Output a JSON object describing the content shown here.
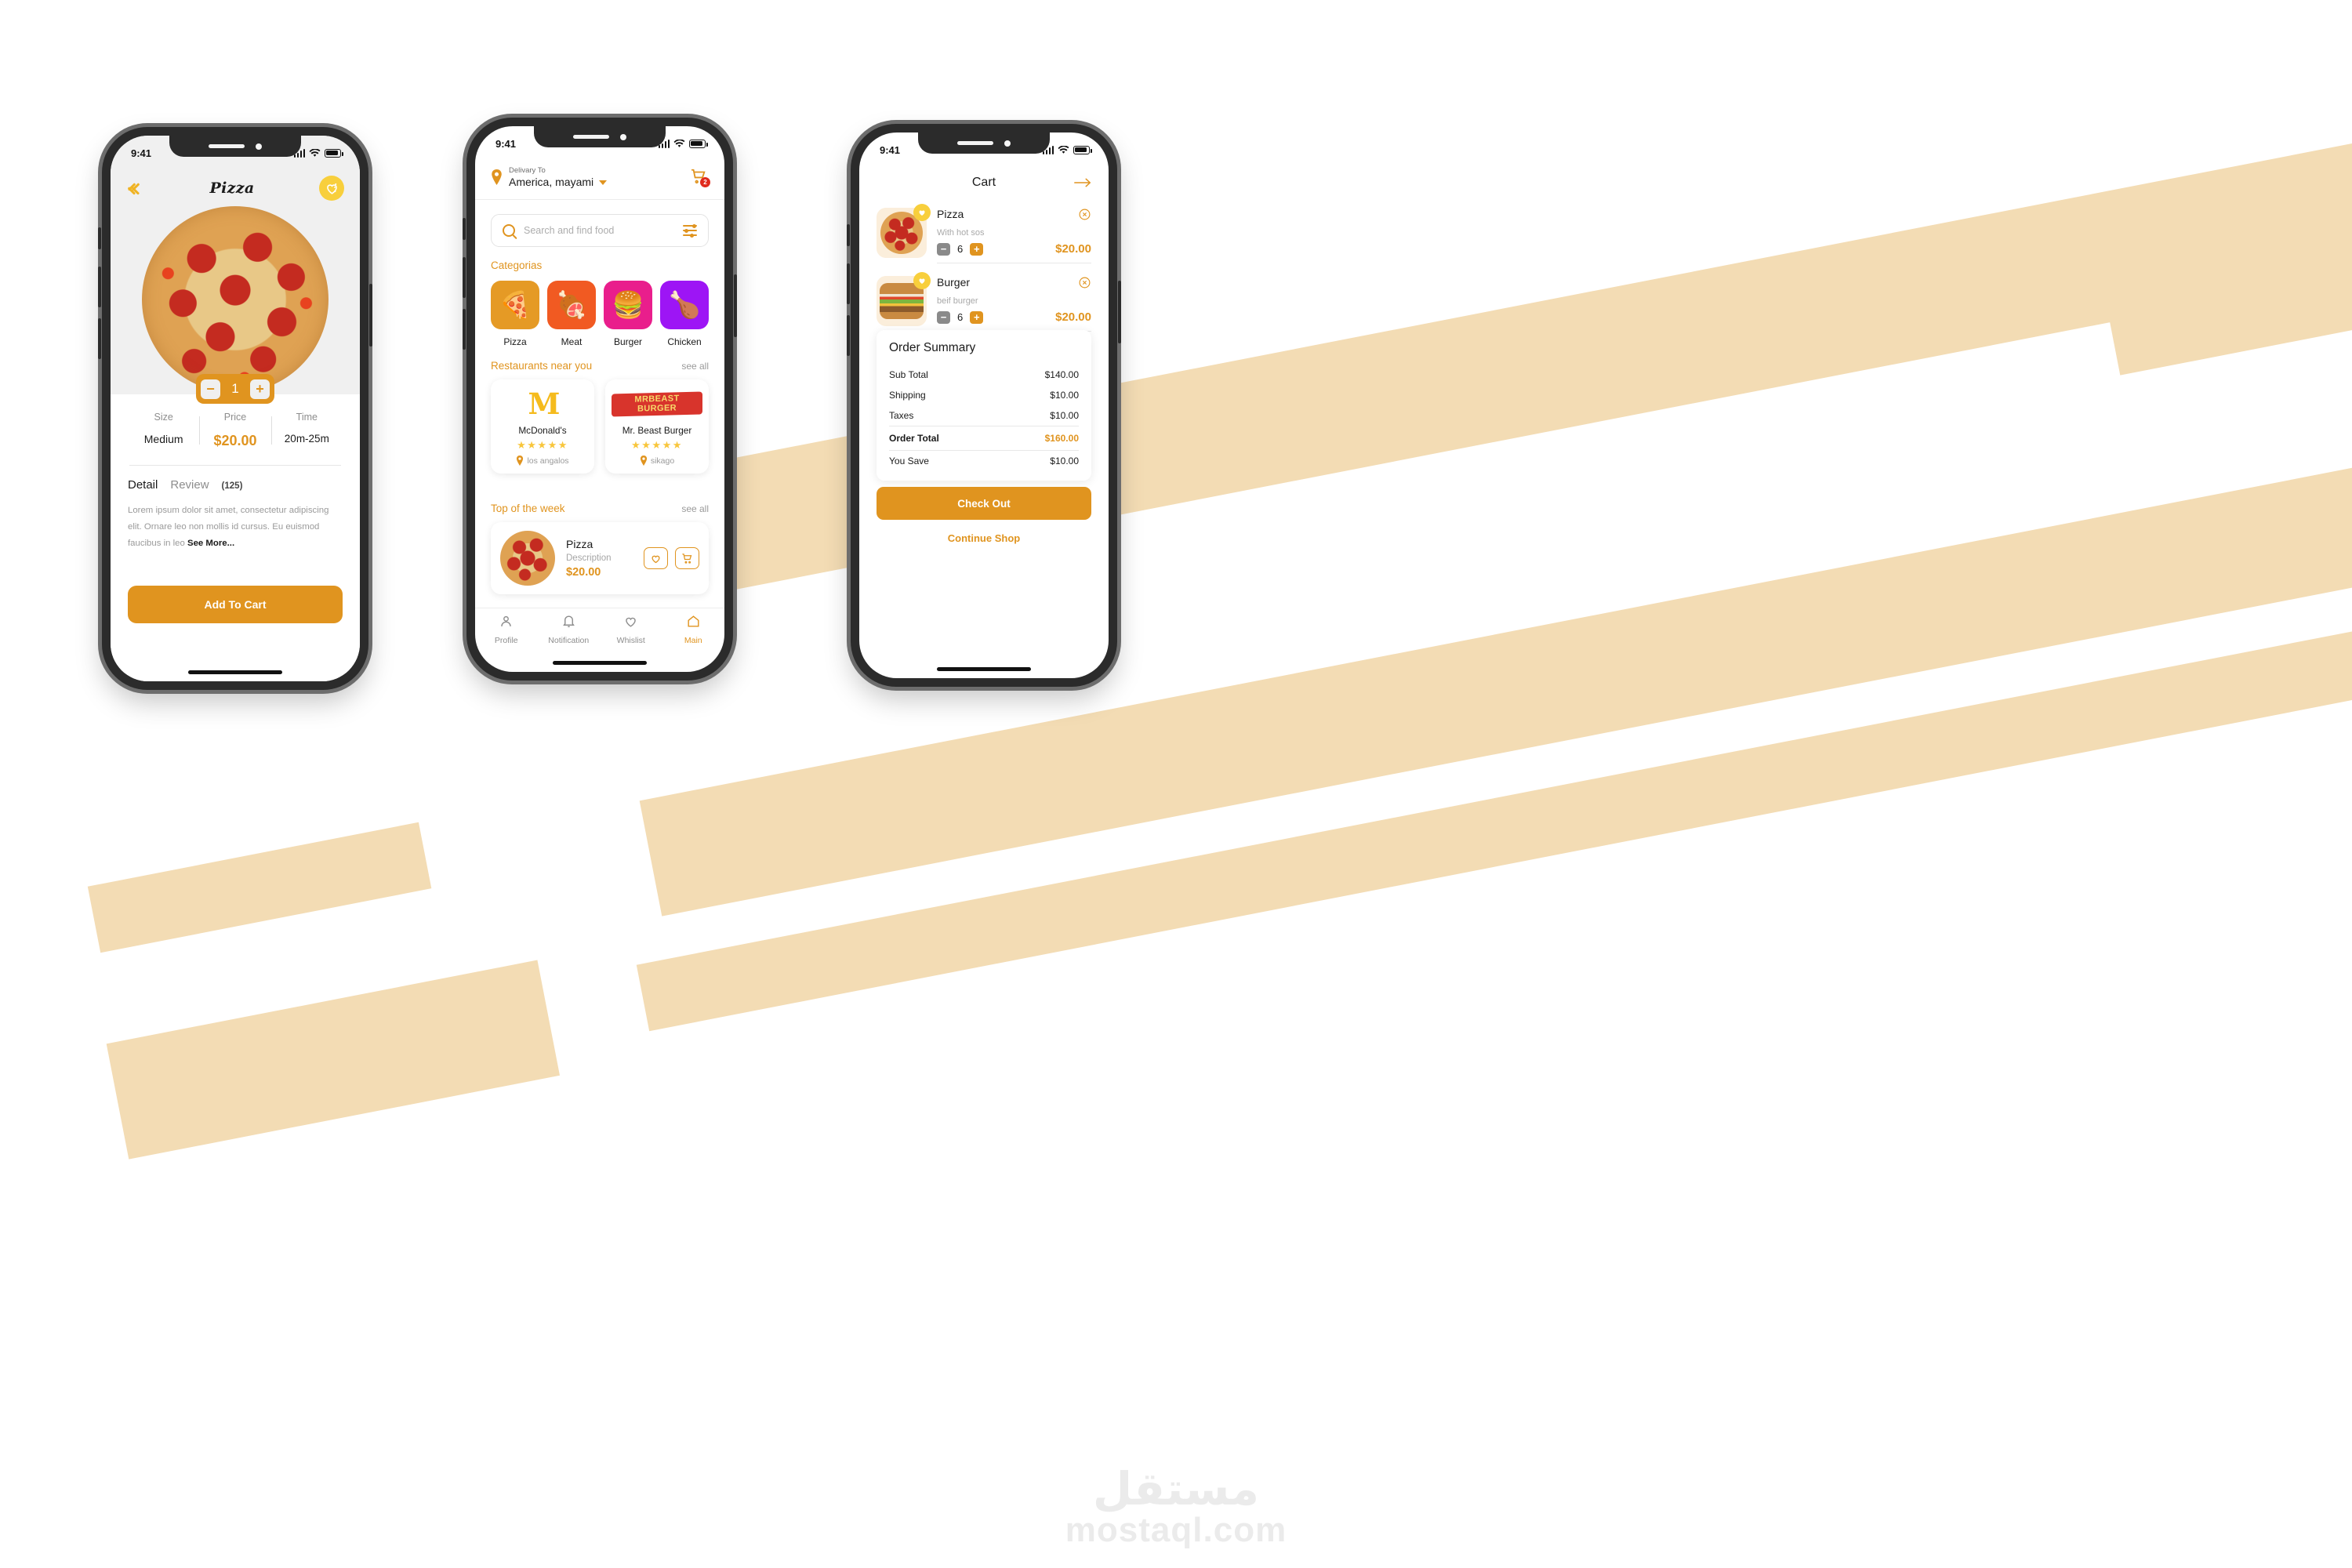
{
  "watermark": {
    "arabic": "مستقل",
    "latin": "mostaql.com"
  },
  "colors": {
    "primary_orange": "#e0941f",
    "accent_yellow": "#f8cf3c",
    "badge_red": "#e02b1d",
    "muted_gray": "#9a9a9a",
    "band_beige": "#f3dcb4"
  },
  "status_bar": {
    "time": "9:41",
    "signal_icon": "signal-bars-icon",
    "wifi_icon": "wifi-icon",
    "battery_icon": "battery-icon"
  },
  "phone1": {
    "nav": {
      "back_icon": "back-arrow-icon",
      "title": "Pizza",
      "favorite_icon": "heart-favorite-icon"
    },
    "hero": {
      "image_alt": "pepperoni-pizza"
    },
    "quantity": {
      "minus": "−",
      "value": "1",
      "plus": "+"
    },
    "specs": [
      {
        "label": "Size",
        "value": "Medium"
      },
      {
        "label": "Price",
        "value": "$20.00"
      },
      {
        "label": "Time",
        "value": "20m-25m"
      }
    ],
    "tabs": {
      "detail": "Detail",
      "review": "Review",
      "review_count": "(125)"
    },
    "description": "Lorem ipsum dolor sit amet, consectetur adipiscing elit. Ornare leo non mollis id cursus. Eu euismod faucibus in leo",
    "see_more": "See More...",
    "cta": "Add To Cart"
  },
  "phone2": {
    "header": {
      "pin_icon": "location-pin-icon",
      "delivery_label": "Delivary To",
      "city": "America, mayami",
      "chevron_icon": "chevron-down-icon",
      "cart_icon": "shopping-cart-icon",
      "cart_badge": "2"
    },
    "search": {
      "icon": "search-icon",
      "placeholder": "Search and find food",
      "filter_icon": "filter-sliders-icon"
    },
    "categories_title": "Categorias",
    "categories": [
      {
        "name": "Pizza",
        "emoji": "🍕",
        "bg": "#e59a25"
      },
      {
        "name": "Meat",
        "emoji": "🍖",
        "bg": "#f15a22"
      },
      {
        "name": "Burger",
        "emoji": "🍔",
        "bg": "#e91e8c"
      },
      {
        "name": "Chicken",
        "emoji": "🍗",
        "bg": "#9d15f5"
      }
    ],
    "restaurants_title": "Restaurants near you",
    "restaurants_see_all": "see all",
    "restaurants": [
      {
        "logo_text": "M",
        "logo_type": "mcdonalds-logo",
        "name": "McDonald's",
        "stars": "★★★★★",
        "location": "los angalos"
      },
      {
        "logo_text": "MRBEAST BURGER",
        "logo_type": "mrbeast-burger-logo",
        "name": "Mr. Beast Burger",
        "stars": "★★★★★",
        "location": "sikago"
      }
    ],
    "top_week_title": "Top of the week",
    "top_week_see_all": "see all",
    "top_week_item": {
      "name": "Pizza",
      "description": "Description",
      "price": "$20.00",
      "heart_icon": "heart-outline-icon",
      "cart_icon": "cart-outline-icon"
    },
    "tabbar": [
      {
        "label": "Profile",
        "icon": "user-icon",
        "active": false
      },
      {
        "label": "Notification",
        "icon": "bell-icon",
        "active": false
      },
      {
        "label": "Whislist",
        "icon": "heart-icon",
        "active": false
      },
      {
        "label": "Main",
        "icon": "home-icon",
        "active": true
      }
    ]
  },
  "phone3": {
    "nav": {
      "title": "Cart",
      "forward_icon": "arrow-right-icon"
    },
    "items": [
      {
        "name": "Pizza",
        "sub": "With hot sos",
        "qty": "6",
        "price": "$20.00",
        "thumb": "pizza-thumb",
        "fav_icon": "heart-filled-icon",
        "remove_icon": "close-circle-icon",
        "minus": "−",
        "plus": "+"
      },
      {
        "name": "Burger",
        "sub": "beif burger",
        "qty": "6",
        "price": "$20.00",
        "thumb": "burger-thumb",
        "fav_icon": "heart-filled-icon",
        "remove_icon": "close-circle-icon",
        "minus": "−",
        "plus": "+"
      }
    ],
    "summary_title": "Order Summary",
    "summary_rows": [
      {
        "label": "Sub Total",
        "value": "$140.00",
        "emphasis": false
      },
      {
        "label": "Shipping",
        "value": "$10.00",
        "emphasis": false
      },
      {
        "label": "Taxes",
        "value": "$10.00",
        "emphasis": false
      },
      {
        "label": "Order Total",
        "value": "$160.00",
        "emphasis": true
      },
      {
        "label": "You Save",
        "value": "$10.00",
        "emphasis": false
      }
    ],
    "checkout": "Check Out",
    "continue": "Continue Shop"
  }
}
